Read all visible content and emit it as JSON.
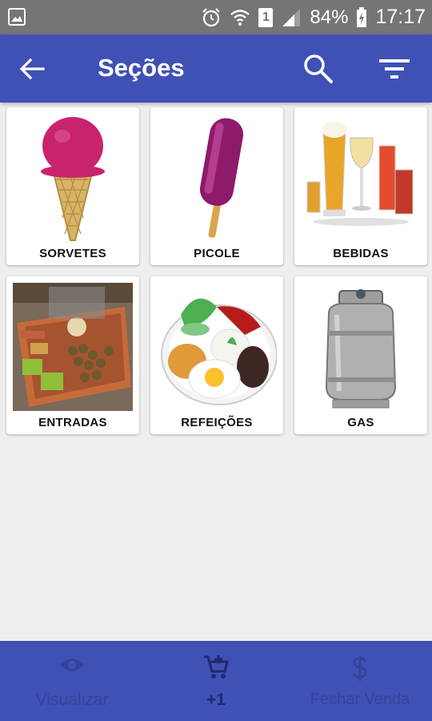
{
  "status_bar": {
    "battery": "84%",
    "time": "17:17",
    "sim": "1"
  },
  "app_bar": {
    "title": "Seções"
  },
  "sections": [
    {
      "label": "SORVETES",
      "image": "ice-cream-cone"
    },
    {
      "label": "PICOLE",
      "image": "popsicle"
    },
    {
      "label": "BEBIDAS",
      "image": "drinks-glasses"
    },
    {
      "label": "ENTRADAS",
      "image": "appetizer-platter"
    },
    {
      "label": "REFEIÇÕES",
      "image": "meal-plate"
    },
    {
      "label": "GAS",
      "image": "gas-cylinder"
    }
  ],
  "bottom_bar": {
    "view_label": "Visualizar",
    "cart_label": "+1",
    "checkout_label": "Fechar Venda"
  },
  "colors": {
    "primary": "#3f51b5",
    "status_bar": "#757575",
    "background": "#eeeeee"
  }
}
